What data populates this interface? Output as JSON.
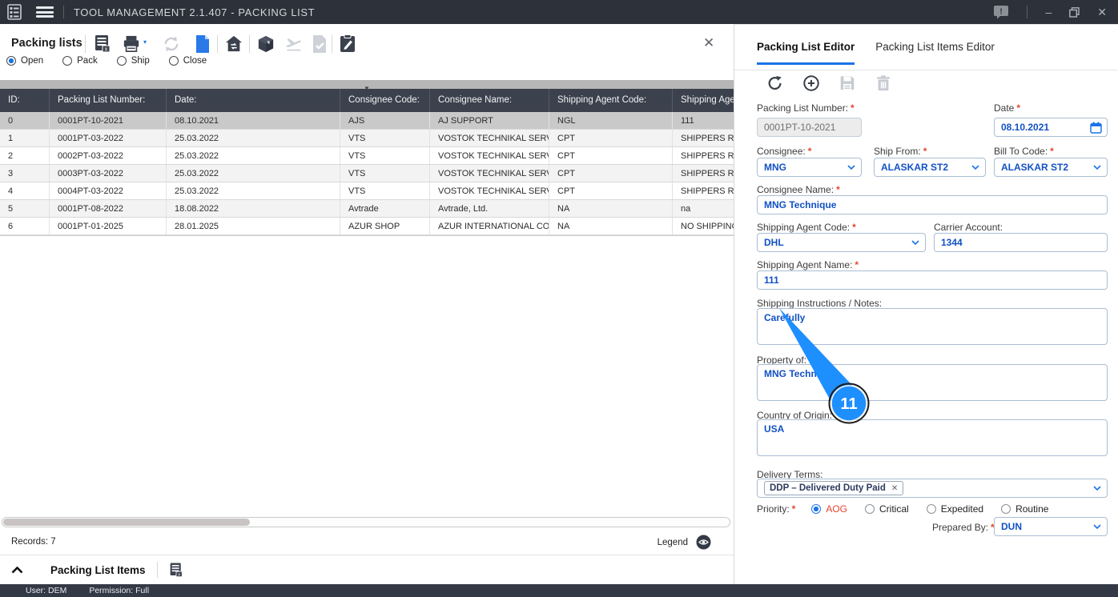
{
  "titlebar": {
    "title": "TOOL MANAGEMENT 2.1.407 - PACKING LIST"
  },
  "icons": {
    "minimize": "–",
    "close": "✕",
    "panel_close": "✕",
    "splitter_caret": "▼",
    "print_caret": "▾",
    "feedback_mark": "!",
    "chip_remove": "✕",
    "required_mark": "*"
  },
  "toolbar": {
    "panel_title": "Packing lists",
    "filters": [
      {
        "label": "Open",
        "selected": true
      },
      {
        "label": "Pack",
        "selected": false
      },
      {
        "label": "Ship",
        "selected": false
      },
      {
        "label": "Close",
        "selected": false
      }
    ]
  },
  "grid": {
    "columns": [
      "ID:",
      "Packing List Number:",
      "Date:",
      "Consignee Code:",
      "Consignee Name:",
      "Shipping Agent Code:",
      "Shipping Agent Name:"
    ],
    "rows": [
      [
        "0",
        "0001PT-10-2021",
        "08.10.2021",
        "AJS",
        "AJ SUPPORT",
        "NGL",
        "111"
      ],
      [
        "1",
        "0001PT-03-2022",
        "25.03.2022",
        "VTS",
        "VOSTOK TECHNIKAL SERVICES",
        "CPT",
        "SHIPPERS RESPONSIBILITY"
      ],
      [
        "2",
        "0002PT-03-2022",
        "25.03.2022",
        "VTS",
        "VOSTOK TECHNIKAL SERVICES",
        "CPT",
        "SHIPPERS RESPONSIBILITY"
      ],
      [
        "3",
        "0003PT-03-2022",
        "25.03.2022",
        "VTS",
        "VOSTOK TECHNIKAL SERVICES",
        "CPT",
        "SHIPPERS RESPONSIBILITY"
      ],
      [
        "4",
        "0004PT-03-2022",
        "25.03.2022",
        "VTS",
        "VOSTOK TECHNIKAL SERVICES",
        "CPT",
        "SHIPPERS RESPONSIBILITY"
      ],
      [
        "5",
        "0001PT-08-2022",
        "18.08.2022",
        "Avtrade",
        "Avtrade, Ltd.",
        "NA",
        "na"
      ],
      [
        "6",
        "0001PT-01-2025",
        "28.01.2025",
        "AZUR SHOP",
        "AZUR INTERNATIONAL COMP...",
        "NA",
        "NO SHIPPING AGENT"
      ]
    ],
    "selected_row": 0,
    "records_label": "Records: 7",
    "legend_label": "Legend"
  },
  "items_section": {
    "title": "Packing List Items"
  },
  "statusbar": {
    "user": "User: DEM",
    "permission": "Permission: Full"
  },
  "editor": {
    "tabs": [
      {
        "label": "Packing List Editor"
      },
      {
        "label": "Packing List Items Editor"
      }
    ],
    "fields": {
      "packing_list_number": {
        "label": "Packing List Number:",
        "value": "0001PT-10-2021"
      },
      "date": {
        "label": "Date",
        "value": "08.10.2021"
      },
      "consignee": {
        "label": "Consignee:",
        "value": "MNG"
      },
      "ship_from": {
        "label": "Ship From:",
        "value": "ALASKAR ST2"
      },
      "bill_to": {
        "label": "Bill To Code:",
        "value": "ALASKAR ST2"
      },
      "consignee_name": {
        "label": "Consignee Name:",
        "value": "MNG Technique"
      },
      "shipping_agent_code": {
        "label": "Shipping Agent Code:",
        "value": "DHL"
      },
      "carrier_account": {
        "label": "Carrier Account:",
        "value": "1344"
      },
      "shipping_agent_name": {
        "label": "Shipping Agent Name:",
        "value": "111"
      },
      "shipping_instructions": {
        "label": "Shipping Instructions / Notes:",
        "value": "Carefully"
      },
      "property_of": {
        "label": "Property of:",
        "value": "MNG Technique"
      },
      "country_of_origin": {
        "label": "Country of Origin:",
        "value": "USA"
      },
      "delivery_terms": {
        "label": "Delivery Terms:",
        "chip": "DDP – Delivered Duty Paid"
      },
      "priority": {
        "label": "Priority:",
        "options": [
          {
            "label": "AOG",
            "selected": true,
            "highlight": true
          },
          {
            "label": "Critical",
            "selected": false
          },
          {
            "label": "Expedited",
            "selected": false
          },
          {
            "label": "Routine",
            "selected": false
          }
        ]
      },
      "prepared_by": {
        "label": "Prepared By:",
        "value": "DUN"
      }
    }
  },
  "annotation": {
    "step_number": "11"
  },
  "colors": {
    "accent_blue": "#1a73e8",
    "value_blue": "#1251c4",
    "annotation_blue": "#1e8fff",
    "required_red": "#e8442f",
    "titlebar_bg": "#2c313a",
    "grid_header_bg": "#3b414d",
    "selected_row_bg": "#c9c9c9",
    "statusbar_bg": "#333a46"
  }
}
